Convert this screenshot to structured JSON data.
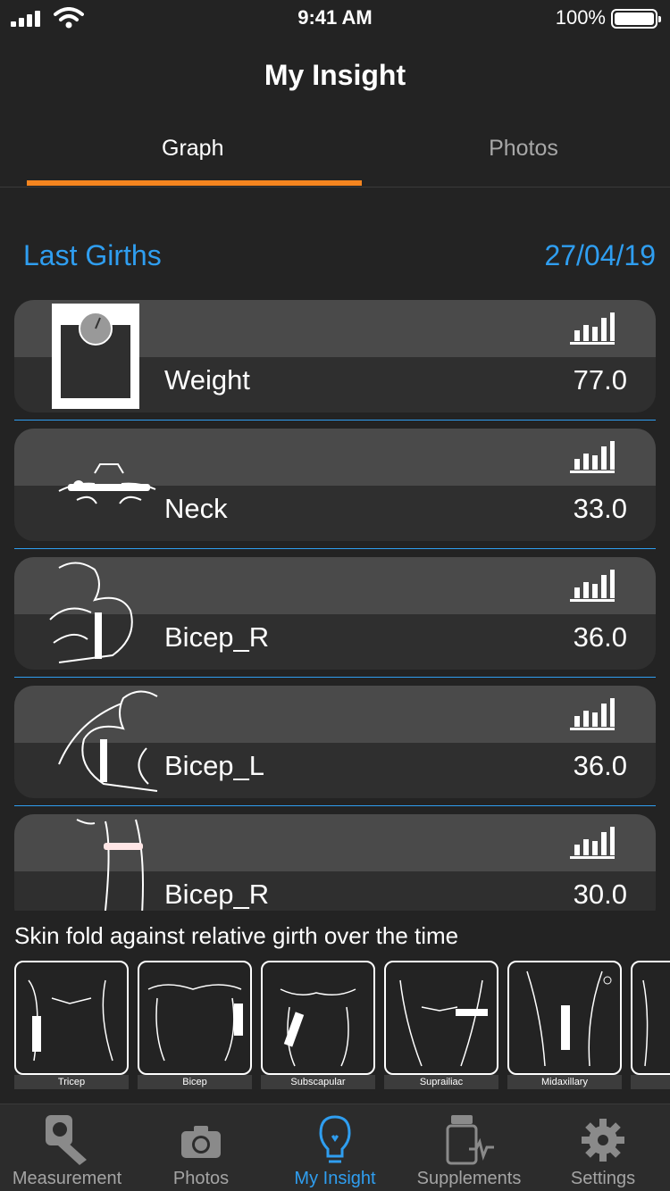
{
  "status_bar": {
    "time": "9:41 AM",
    "battery": "100%"
  },
  "nav": {
    "title": "My Insight"
  },
  "tabs": [
    {
      "label": "Graph",
      "active": true
    },
    {
      "label": "Photos",
      "active": false
    }
  ],
  "section": {
    "title": "Last Girths",
    "date": "27/04/19"
  },
  "measurements": [
    {
      "label": "Weight",
      "value": "77.0",
      "icon": "scale-icon"
    },
    {
      "label": "Neck",
      "value": "33.0",
      "icon": "neck-tape-icon"
    },
    {
      "label": "Bicep_R",
      "value": "36.0",
      "icon": "bicep-right-icon"
    },
    {
      "label": "Bicep_L",
      "value": "36.0",
      "icon": "bicep-left-icon"
    },
    {
      "label": "Bicep_R",
      "value": "30.0",
      "icon": "arm-tape-icon"
    }
  ],
  "skinfold": {
    "caption": "Skin fold against relative girth over the time",
    "sites": [
      "Tricep",
      "Bicep",
      "Subscapular",
      "Suprailiac",
      "Midaxillary"
    ]
  },
  "tabbar": [
    {
      "label": "Measurement",
      "icon": "measurement-icon",
      "active": false
    },
    {
      "label": "Photos",
      "icon": "camera-icon",
      "active": false
    },
    {
      "label": "My Insight",
      "icon": "lightbulb-icon",
      "active": true
    },
    {
      "label": "Supplements",
      "icon": "supplements-icon",
      "active": false
    },
    {
      "label": "Settings",
      "icon": "gear-icon",
      "active": false
    }
  ],
  "colors": {
    "accent_blue": "#2f9ef0",
    "accent_orange": "#f5851f",
    "background": "#232323"
  }
}
